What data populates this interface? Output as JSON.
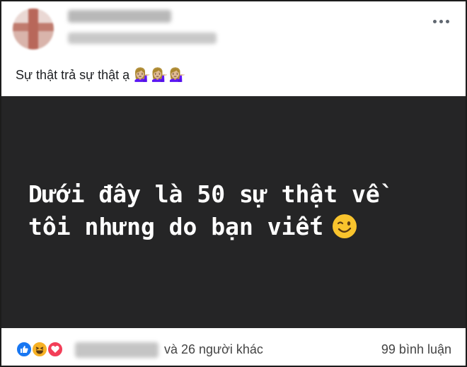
{
  "post": {
    "caption": "Sự thật trả sự thật ạ",
    "caption_emoji": "💁🏼‍♀️💁🏼‍♀️💁🏼‍♀️",
    "more_icon": "more-horizontal-icon"
  },
  "image": {
    "line1": "Dưới đây là 50 sự thật về",
    "line2": "tôi nhưng do bạn viết",
    "emoji": "wink-face-icon",
    "background": "#252526"
  },
  "footer": {
    "reaction_icons": [
      "like-icon",
      "haha-icon",
      "love-icon"
    ],
    "others_text": "và 26 người khác",
    "comments_text": "99 bình luận"
  },
  "colors": {
    "like": "#1877f2",
    "haha": "#f7b125",
    "love": "#f33e58"
  }
}
